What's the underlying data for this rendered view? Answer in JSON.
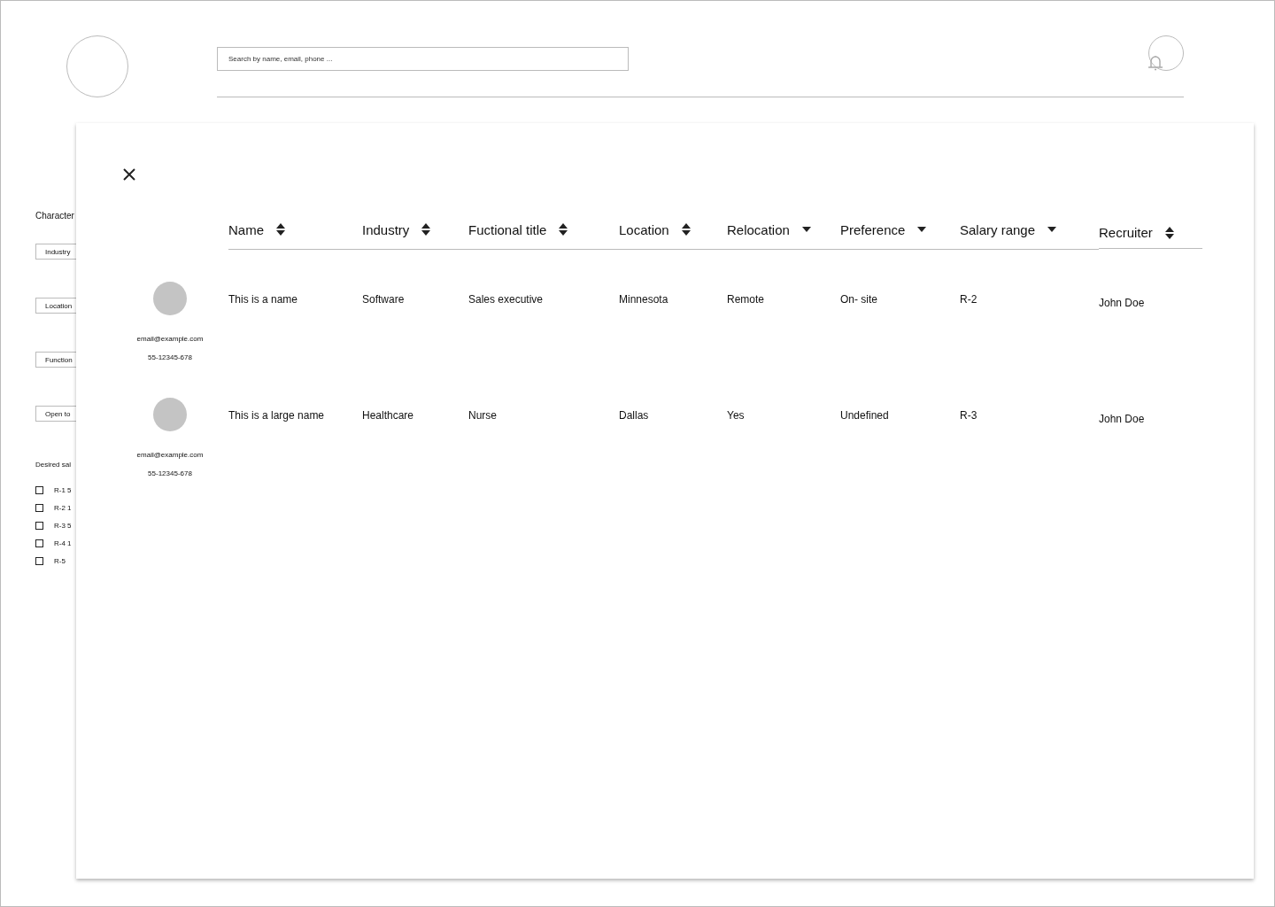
{
  "header": {
    "search": {
      "placeholder": "Search by name, email, phone ..."
    }
  },
  "sidebar": {
    "title": "Character",
    "filters": [
      "Industry",
      "Location",
      "Function",
      "Open to"
    ],
    "salary_title": "Desired sal",
    "salary_options": [
      {
        "label": "R-1 5",
        "checked": false
      },
      {
        "label": "R-2 1",
        "checked": false
      },
      {
        "label": "R-3 5",
        "checked": false
      },
      {
        "label": "R-4 1",
        "checked": false
      },
      {
        "label": "R-5",
        "checked": false
      }
    ]
  },
  "modal": {
    "columns": [
      {
        "label": "Name",
        "kind": "sortable"
      },
      {
        "label": "Industry",
        "kind": "sortable"
      },
      {
        "label": "Fuctional title",
        "kind": "sortable"
      },
      {
        "label": "Location",
        "kind": "sortable"
      },
      {
        "label": "Relocation",
        "kind": "dropdown"
      },
      {
        "label": "Preference",
        "kind": "dropdown"
      },
      {
        "label": "Salary range",
        "kind": "dropdown"
      },
      {
        "label": "Recruiter",
        "kind": "sortable"
      }
    ],
    "rows": [
      {
        "email": "email@example.com",
        "phone": "55-12345-678",
        "cells": [
          "This is a name",
          "Software",
          "Sales executive",
          "Minnesota",
          "Remote",
          "On- site",
          "R-2",
          "John Doe"
        ]
      },
      {
        "email": "email@example.com",
        "phone": "55-12345-678",
        "cells": [
          "This is a large name",
          "Healthcare",
          "Nurse",
          "Dallas",
          "Yes",
          "Undefined",
          "R-3",
          "John Doe"
        ]
      }
    ]
  }
}
